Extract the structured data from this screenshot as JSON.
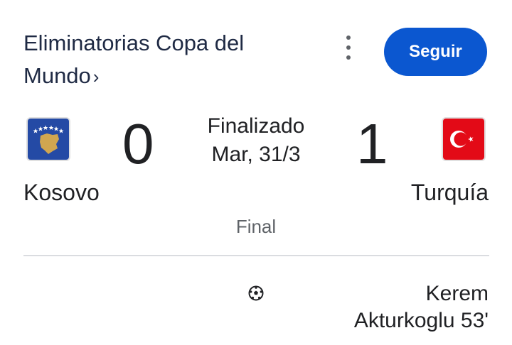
{
  "header": {
    "title": "Eliminatorias Copa del Mundo",
    "title_chevron": "›",
    "follow_label": "Seguir",
    "more_icon": "more-vert-icon"
  },
  "match": {
    "status": "Finalizado",
    "date": "Mar, 31/3",
    "stage": "Final",
    "home": {
      "name": "Kosovo",
      "score": "0",
      "flag_icon": "kosovo-flag-icon"
    },
    "away": {
      "name": "Turquía",
      "score": "1",
      "flag_icon": "turkey-flag-icon"
    }
  },
  "events": [
    {
      "type": "goal",
      "icon": "soccer-ball-icon",
      "team": "away",
      "player_line1": "Kerem",
      "player_line2": "Akturkoglu 53'"
    }
  ],
  "colors": {
    "accent": "#0b57d0",
    "text": "#202124",
    "muted": "#5f6368",
    "divider": "#dadce0",
    "kosovo_blue": "#244aa5",
    "kosovo_gold": "#d0a650",
    "turkey_red": "#e30a17"
  }
}
